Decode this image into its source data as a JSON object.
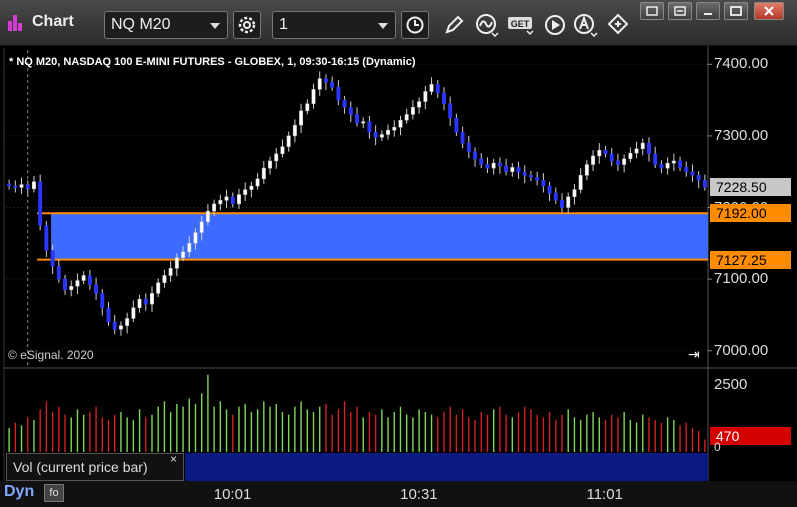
{
  "toolbar": {
    "app_title": "Chart",
    "symbol": "NQ M20",
    "interval": "1",
    "get_label": "GET"
  },
  "chart": {
    "header": "* NQ M20, NASDAQ 100 E-MINI FUTURES - GLOBEX, 1, 09:30-16:15 (Dynamic)",
    "copyright": "© eSignal. 2020",
    "vol_tab_label": "Vol (current price bar)",
    "vol_tab_close": "×",
    "dyn_label": "Dyn",
    "dyn_icon_label": "fo"
  },
  "colors": {
    "up_candle": "#ffffff",
    "down_candle": "#2a36ff",
    "zone_fill": "#3e6bff",
    "zone_line": "#ff8c00",
    "vol_up": "#7ed957",
    "vol_down": "#d22222",
    "last_price_tag": "#c8c8c8",
    "vol_tag": "#d40000"
  },
  "chart_data": {
    "type": "candlestick",
    "title": "* NQ M20, NASDAQ 100 E-MINI FUTURES - GLOBEX, 1, 09:30-16:15 (Dynamic)",
    "price_axis": {
      "ticks": [
        "7400.00",
        "7300.00",
        "7200.00",
        "7100.00",
        "7000.00"
      ],
      "tick_values": [
        7400,
        7300,
        7200,
        7100,
        7000
      ],
      "range": [
        6980,
        7420
      ]
    },
    "volume_axis": {
      "ticks": [
        "2500"
      ],
      "tick_values": [
        2500
      ],
      "extra_label": "0",
      "range": [
        0,
        3000
      ]
    },
    "time_axis": {
      "ticks": [
        "10:01",
        "10:31",
        "11:01"
      ],
      "tick_index": [
        36,
        66,
        96
      ]
    },
    "price_tags": [
      {
        "label": "7228.50",
        "value": 7228.5,
        "kind": "last"
      },
      {
        "label": "7192.00",
        "value": 7192.0,
        "kind": "zone-top"
      },
      {
        "label": "7127.25",
        "value": 7127.25,
        "kind": "zone-bottom"
      }
    ],
    "volume_tag": {
      "label": "470",
      "value": 470
    },
    "zone": {
      "top": 7192.0,
      "bottom": 7127.25,
      "start_index": 5
    },
    "cursor_index": 5,
    "closes": [
      7230,
      7228,
      7232,
      7226,
      7236,
      7175,
      7140,
      7118,
      7100,
      7085,
      7090,
      7098,
      7105,
      7092,
      7080,
      7060,
      7040,
      7030,
      7035,
      7045,
      7060,
      7072,
      7065,
      7080,
      7095,
      7105,
      7115,
      7130,
      7138,
      7150,
      7165,
      7180,
      7195,
      7205,
      7210,
      7215,
      7205,
      7218,
      7225,
      7230,
      7240,
      7255,
      7265,
      7275,
      7285,
      7300,
      7315,
      7335,
      7345,
      7365,
      7380,
      7375,
      7368,
      7350,
      7340,
      7330,
      7318,
      7320,
      7305,
      7298,
      7302,
      7308,
      7312,
      7322,
      7330,
      7340,
      7348,
      7362,
      7372,
      7360,
      7345,
      7325,
      7305,
      7290,
      7278,
      7268,
      7260,
      7255,
      7262,
      7258,
      7250,
      7256,
      7249,
      7245,
      7242,
      7238,
      7230,
      7220,
      7210,
      7200,
      7215,
      7225,
      7245,
      7260,
      7272,
      7280,
      7275,
      7265,
      7260,
      7268,
      7276,
      7282,
      7290,
      7275,
      7260,
      7255,
      7262,
      7265,
      7256,
      7250,
      7245,
      7238,
      7228.5
    ],
    "volumes": [
      900,
      1100,
      1000,
      1300,
      1200,
      1600,
      1900,
      1500,
      1700,
      1400,
      1300,
      1600,
      1400,
      1500,
      1700,
      1300,
      1200,
      1400,
      1500,
      1300,
      1200,
      1600,
      1300,
      1400,
      1700,
      1900,
      1500,
      1800,
      1700,
      2000,
      1800,
      2200,
      2900,
      1700,
      1900,
      1600,
      1400,
      1700,
      1800,
      1500,
      1600,
      1900,
      1700,
      1800,
      1500,
      1400,
      1700,
      1900,
      1600,
      1500,
      1700,
      1800,
      1400,
      1600,
      1900,
      1500,
      1700,
      1300,
      1500,
      1400,
      1600,
      1300,
      1500,
      1700,
      1400,
      1300,
      1600,
      1500,
      1400,
      1300,
      1500,
      1700,
      1400,
      1600,
      1300,
      1200,
      1500,
      1400,
      1600,
      1700,
      1400,
      1300,
      1500,
      1700,
      1600,
      1400,
      1300,
      1500,
      1200,
      1400,
      1600,
      1300,
      1200,
      1400,
      1500,
      1300,
      1200,
      1400,
      1300,
      1500,
      1200,
      1100,
      1400,
      1300,
      1200,
      1100,
      1300,
      1200,
      1000,
      1100,
      900,
      800,
      470
    ]
  }
}
